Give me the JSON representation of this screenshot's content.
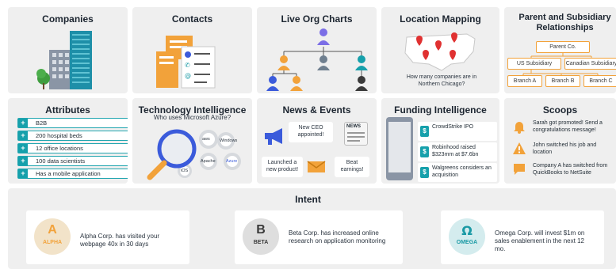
{
  "tiles": {
    "companies": {
      "title": "Companies"
    },
    "contacts": {
      "title": "Contacts"
    },
    "org_charts": {
      "title": "Live Org Charts"
    },
    "location": {
      "title": "Location Mapping",
      "question": "How many companies are in Northern Chicago?"
    },
    "parent": {
      "title": "Parent and Subsidiary Relationships",
      "root": "Parent Co.",
      "subsidiaries": [
        "US Subsidiary",
        "Canadian Subsidiary"
      ],
      "branches": [
        "Branch A",
        "Branch B",
        "Branch C"
      ]
    },
    "attributes": {
      "title": "Attributes",
      "items": [
        "B2B",
        "200 hospital beds",
        "12 office locations",
        "100 data scientists",
        "Has a mobile application"
      ]
    },
    "tech": {
      "title": "Technology Intelligence",
      "subtitle": "Who uses Microsoft Azure?",
      "gear_labels": [
        "aws",
        "Windows",
        "Apache",
        "iOS",
        "Azure"
      ]
    },
    "news": {
      "title": "News & Events",
      "bubbles": [
        "New CEO appointed!",
        "Launched a new product!",
        "Beat earnings!"
      ],
      "paper_label": "NEWS"
    },
    "funding": {
      "title": "Funding Intelligence",
      "items": [
        "CrowdStrike IPO",
        "Robinhood raised $323mm at $7.6bn",
        "Walgreens considers an acquisition"
      ]
    },
    "scoops": {
      "title": "Scoops",
      "items": [
        "Sarah got promoted! Send a congratulations message!",
        "John switched his job and location",
        "Company A has switched from QuickBooks to NetSuite"
      ]
    }
  },
  "intent": {
    "title": "Intent",
    "cards": [
      {
        "logo": "ALPHA",
        "logo_glyph": "A",
        "text": "Alpha Corp. has visited your webpage 40x in 30 days",
        "color": "#f2a23a"
      },
      {
        "logo": "BETA",
        "logo_glyph": "B",
        "text": "Beta Corp. has increased online research on application monitoring",
        "color": "#3a3a3a"
      },
      {
        "logo": "OMEGA",
        "logo_glyph": "Ω",
        "text": "Omega Corp. will invest $1m on sales enablement in the next 12 mo.",
        "color": "#1b9aa5"
      }
    ]
  },
  "colors": {
    "teal": "#16a0ab",
    "orange": "#f2a23a",
    "blue": "#3b5bdb",
    "tile": "#efefef"
  }
}
